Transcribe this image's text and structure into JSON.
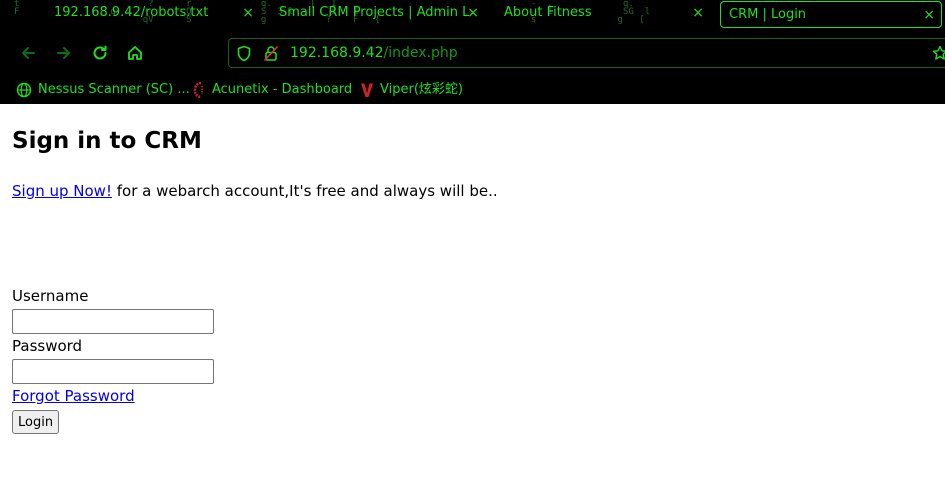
{
  "browser": {
    "tabs": [
      {
        "title": "192.168.9.42/robots.txt",
        "close": "×",
        "active": false
      },
      {
        "title": "Small CRM Projects | Admin L",
        "close": "×",
        "active": false
      },
      {
        "title": "About Fitness",
        "close": "×",
        "active": false
      },
      {
        "title": "CRM | Login",
        "close": "×",
        "active": true
      }
    ],
    "url": {
      "host": "192.168.9.42",
      "path": "/index.php"
    },
    "bookmarks": [
      {
        "label": "Nessus Scanner (SC) ...",
        "icon": "globe-icon"
      },
      {
        "label": "Acunetix - Dashboard",
        "icon": "acunetix-icon"
      },
      {
        "label": "Viper(炫彩蛇)",
        "icon": "viper-icon"
      }
    ],
    "theme": {
      "accent": "#1ee01e",
      "background": "#000000"
    }
  },
  "page": {
    "title": "Sign in to CRM",
    "signup_link": "Sign up Now!",
    "signup_text": " for a webarch account,It's free and always will be..",
    "username_label": "Username",
    "username_value": "",
    "password_label": "Password",
    "password_value": "",
    "forgot_link": "Forgot Password ",
    "login_button": "Login"
  }
}
